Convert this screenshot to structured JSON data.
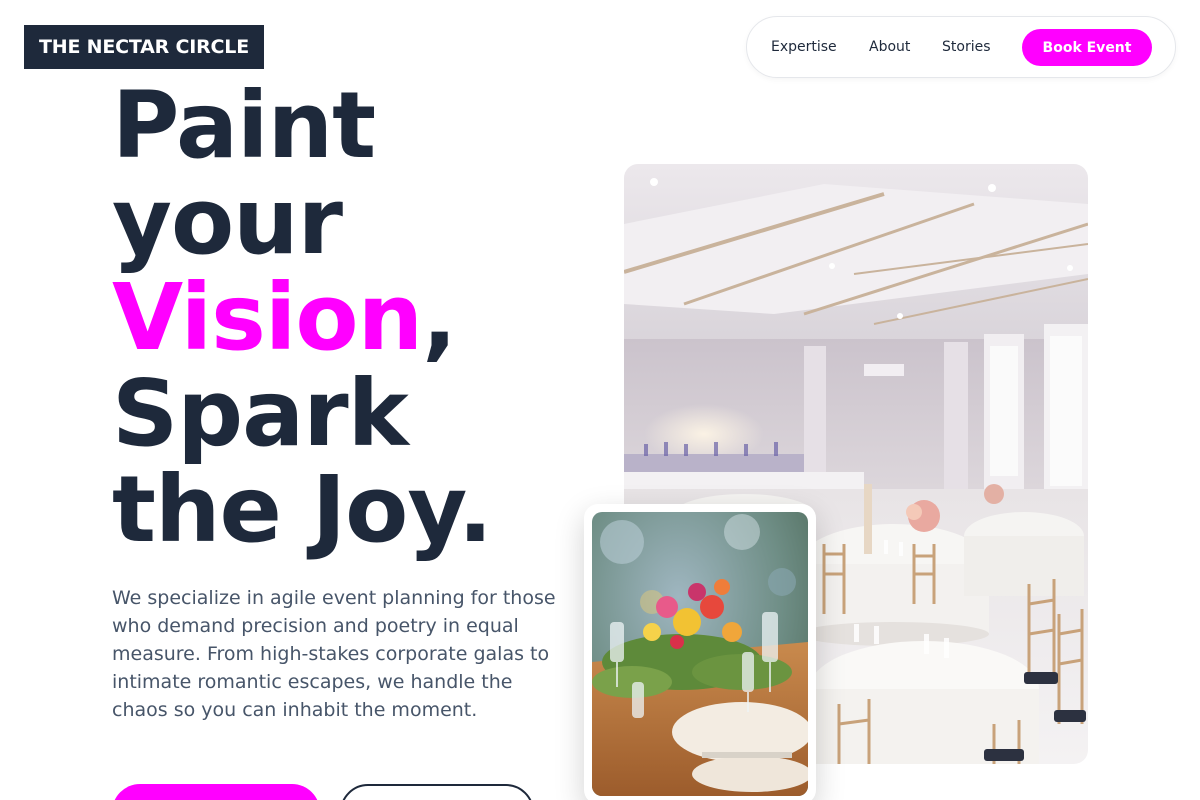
{
  "brand": {
    "name": "THE NECTAR CIRCLE"
  },
  "nav": {
    "links": [
      "Expertise",
      "About",
      "Stories"
    ],
    "cta": "Book Event"
  },
  "hero": {
    "line1": "Paint",
    "line2": "your",
    "line3_accent": "Vision",
    "line3_rest": ",",
    "line4": "Spark",
    "line5": "the Joy.",
    "description": "We specialize in agile event planning for those who demand precision and poetry in equal measure. From high-stakes corporate galas to intimate romantic escapes, we handle the chaos so you can inhabit the moment."
  },
  "colors": {
    "accent": "#ff00ff",
    "dark": "#1e293b",
    "muted": "#475569"
  }
}
